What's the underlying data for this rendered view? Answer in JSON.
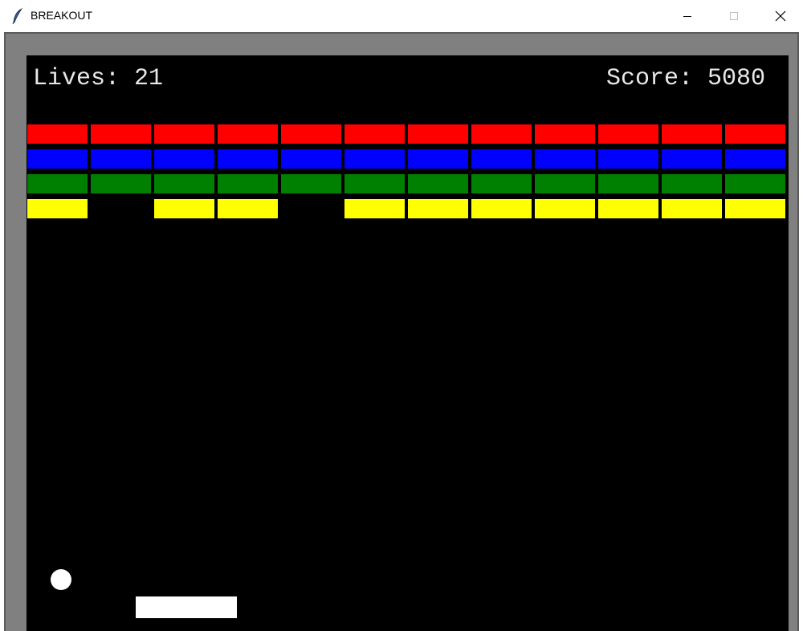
{
  "window": {
    "title": "BREAKOUT"
  },
  "hud": {
    "lives": "Lives: 21",
    "score": "Score: 5080"
  },
  "game": {
    "columns": 12,
    "brick_rows": [
      {
        "color": "#ff0000",
        "present": [
          true,
          true,
          true,
          true,
          true,
          true,
          true,
          true,
          true,
          true,
          true,
          true
        ]
      },
      {
        "color": "#0000ff",
        "present": [
          true,
          true,
          true,
          true,
          true,
          true,
          true,
          true,
          true,
          true,
          true,
          true
        ]
      },
      {
        "color": "#008000",
        "present": [
          true,
          true,
          true,
          true,
          true,
          true,
          true,
          true,
          true,
          true,
          true,
          true
        ]
      },
      {
        "color": "#ffff00",
        "present": [
          true,
          false,
          true,
          true,
          false,
          true,
          true,
          true,
          true,
          true,
          true,
          true
        ]
      }
    ],
    "ball_color": "#ffffff",
    "paddle_color": "#ffffff",
    "background_color": "#000000",
    "frame_color": "#808080"
  },
  "icons": {
    "app": "feather-icon",
    "minimize": "minimize-icon",
    "maximize": "maximize-icon",
    "close": "close-icon"
  }
}
